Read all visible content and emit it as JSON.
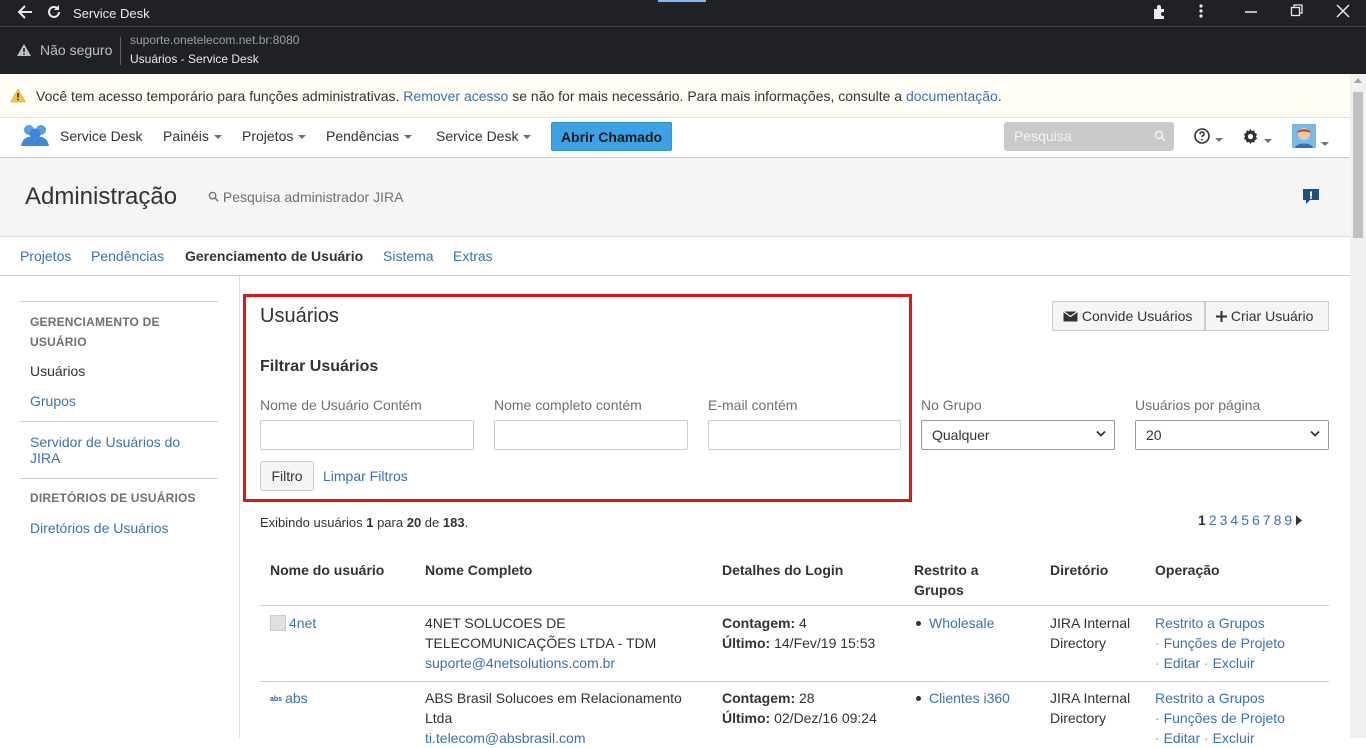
{
  "browser": {
    "window_title": "Service Desk",
    "security_label": "Não seguro",
    "url": "suporte.onetelecom.net.br:8080",
    "page_title": "Usuários - Service Desk"
  },
  "banner": {
    "text_before": "Você tem acesso temporário para funções administrativas. ",
    "remove_link": "Remover acesso",
    "text_middle": " se não for mais necessário. Para mais informações, consulte a ",
    "doc_link": "documentação",
    "text_after": "."
  },
  "header": {
    "app_name": "Service Desk",
    "nav": [
      "Painéis",
      "Projetos",
      "Pendências",
      "Service Desk"
    ],
    "create_button": "Abrir Chamado",
    "search_placeholder": "Pesquisa"
  },
  "admin": {
    "title": "Administração",
    "search_placeholder": "Pesquisa administrador JIRA",
    "tabs": [
      "Projetos",
      "Pendências",
      "Gerenciamento de Usuário",
      "Sistema",
      "Extras"
    ]
  },
  "sidebar": {
    "section1_title": "GERENCIAMENTO DE USUÁRIO",
    "users": "Usuários",
    "groups": "Grupos",
    "server": "Servidor de Usuários do JIRA",
    "section2_title": "DIRETÓRIOS DE USUÁRIOS",
    "directories": "Diretórios de Usuários"
  },
  "main": {
    "title": "Usuários",
    "invite_button": "Convide Usuários",
    "create_button": "Criar Usuário",
    "filter_title": "Filtrar Usuários",
    "label_username": "Nome de Usuário Contém",
    "label_fullname": "Nome completo contém",
    "label_email": "E-mail contém",
    "label_group": "No Grupo",
    "label_per_page": "Usuários por página",
    "group_value": "Qualquer",
    "per_page_value": "20",
    "filter_button": "Filtro",
    "clear_filters": "Limpar Filtros",
    "showing_prefix": "Exibindo usuários ",
    "showing_from": "1",
    "showing_to_word": " para ",
    "showing_to": "20",
    "showing_of_word": " de ",
    "showing_total": "183",
    "showing_suffix": ".",
    "pages": [
      "1",
      "2",
      "3",
      "4",
      "5",
      "6",
      "7",
      "8",
      "9"
    ]
  },
  "table": {
    "headers": [
      "Nome do usuário",
      "Nome Completo",
      "Detalhes do Login",
      "Restrito a Grupos",
      "Diretório",
      "Operação"
    ],
    "rows": [
      {
        "username": "4net",
        "fullname": "4NET SOLUCOES DE TELECOMUNICAÇÕES LTDA - TDM",
        "email": "suporte@4netsolutions.com.br",
        "count_label": "Contagem:",
        "count": "4",
        "last_label": "Último:",
        "last": "14/Fev/19 15:53",
        "group": "Wholesale",
        "directory": "JIRA Internal Directory",
        "op_restrict": "Restrito a Grupos",
        "op_roles": "Funções de Projeto",
        "op_edit": "Editar",
        "op_delete": "Excluir"
      },
      {
        "username": "abs",
        "logo_text": "abs",
        "fullname": "ABS Brasil Solucoes em Relacionamento Ltda",
        "email": "ti.telecom@absbrasil.com",
        "count_label": "Contagem:",
        "count": "28",
        "last_label": "Último:",
        "last": "02/Dez/16 09:24",
        "group": "Clientes i360",
        "directory": "JIRA Internal Directory",
        "op_restrict": "Restrito a Grupos",
        "op_roles": "Funções de Projeto",
        "op_edit": "Editar",
        "op_delete": "Excluir"
      }
    ]
  }
}
